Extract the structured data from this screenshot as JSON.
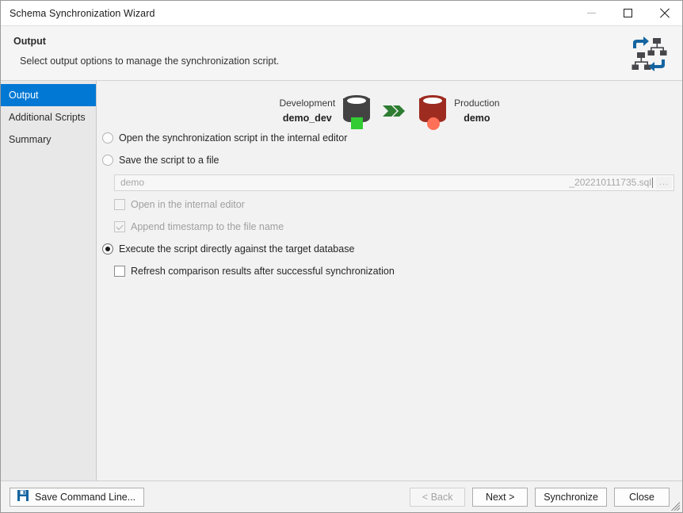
{
  "window": {
    "title": "Schema Synchronization Wizard",
    "buttons": {
      "minimize": "minimize-icon",
      "maximize": "maximize-icon",
      "close": "close-icon"
    }
  },
  "header": {
    "title": "Output",
    "subtitle": "Select output options to manage the synchronization script.",
    "icon": "schema-sync-icon",
    "icon_colors": {
      "node": "#46464b",
      "arrow": "#1464a0"
    }
  },
  "sidebar": {
    "items": [
      {
        "label": "Output",
        "active": true
      },
      {
        "label": "Additional Scripts",
        "active": false
      },
      {
        "label": "Summary",
        "active": false
      }
    ],
    "accent": "#0078d4"
  },
  "db_summary": {
    "source": {
      "role": "Development",
      "name": "demo_dev",
      "icon": "database-icon",
      "color": "#434343",
      "badge": "square-badge",
      "badge_color": "#33cc33"
    },
    "arrow": {
      "icon": "arrow-right-icon",
      "color": "#2e7d32"
    },
    "target": {
      "role": "Production",
      "name": "demo",
      "icon": "database-icon",
      "color": "#9e2b20",
      "badge": "circle-badge",
      "badge_color": "#ff7058"
    }
  },
  "options": {
    "open_in_editor": {
      "label": "Open the synchronization script in the internal editor",
      "checked": false
    },
    "save_to_file": {
      "label": "Save the script to a file",
      "checked": false
    },
    "file_field": {
      "prefix": "demo",
      "suffix": "_202210111735.sql",
      "browse_label": "...",
      "disabled": true
    },
    "sub_open_in_editor": {
      "label": "Open in the internal editor",
      "checked": false,
      "disabled": true
    },
    "sub_append_timestamp": {
      "label": "Append timestamp to the file name",
      "checked": true,
      "disabled": true
    },
    "execute_directly": {
      "label": "Execute the script directly against the target database",
      "checked": true
    },
    "refresh_after_sync": {
      "label": "Refresh comparison results after successful synchronization",
      "checked": false,
      "disabled": false
    }
  },
  "footer": {
    "save_command_line": "Save Command Line...",
    "save_icon": "floppy-disk-icon",
    "back": "< Back",
    "back_disabled": true,
    "next": "Next >",
    "synchronize": "Synchronize",
    "close": "Close",
    "resize_grip": "resize-grip-icon"
  }
}
